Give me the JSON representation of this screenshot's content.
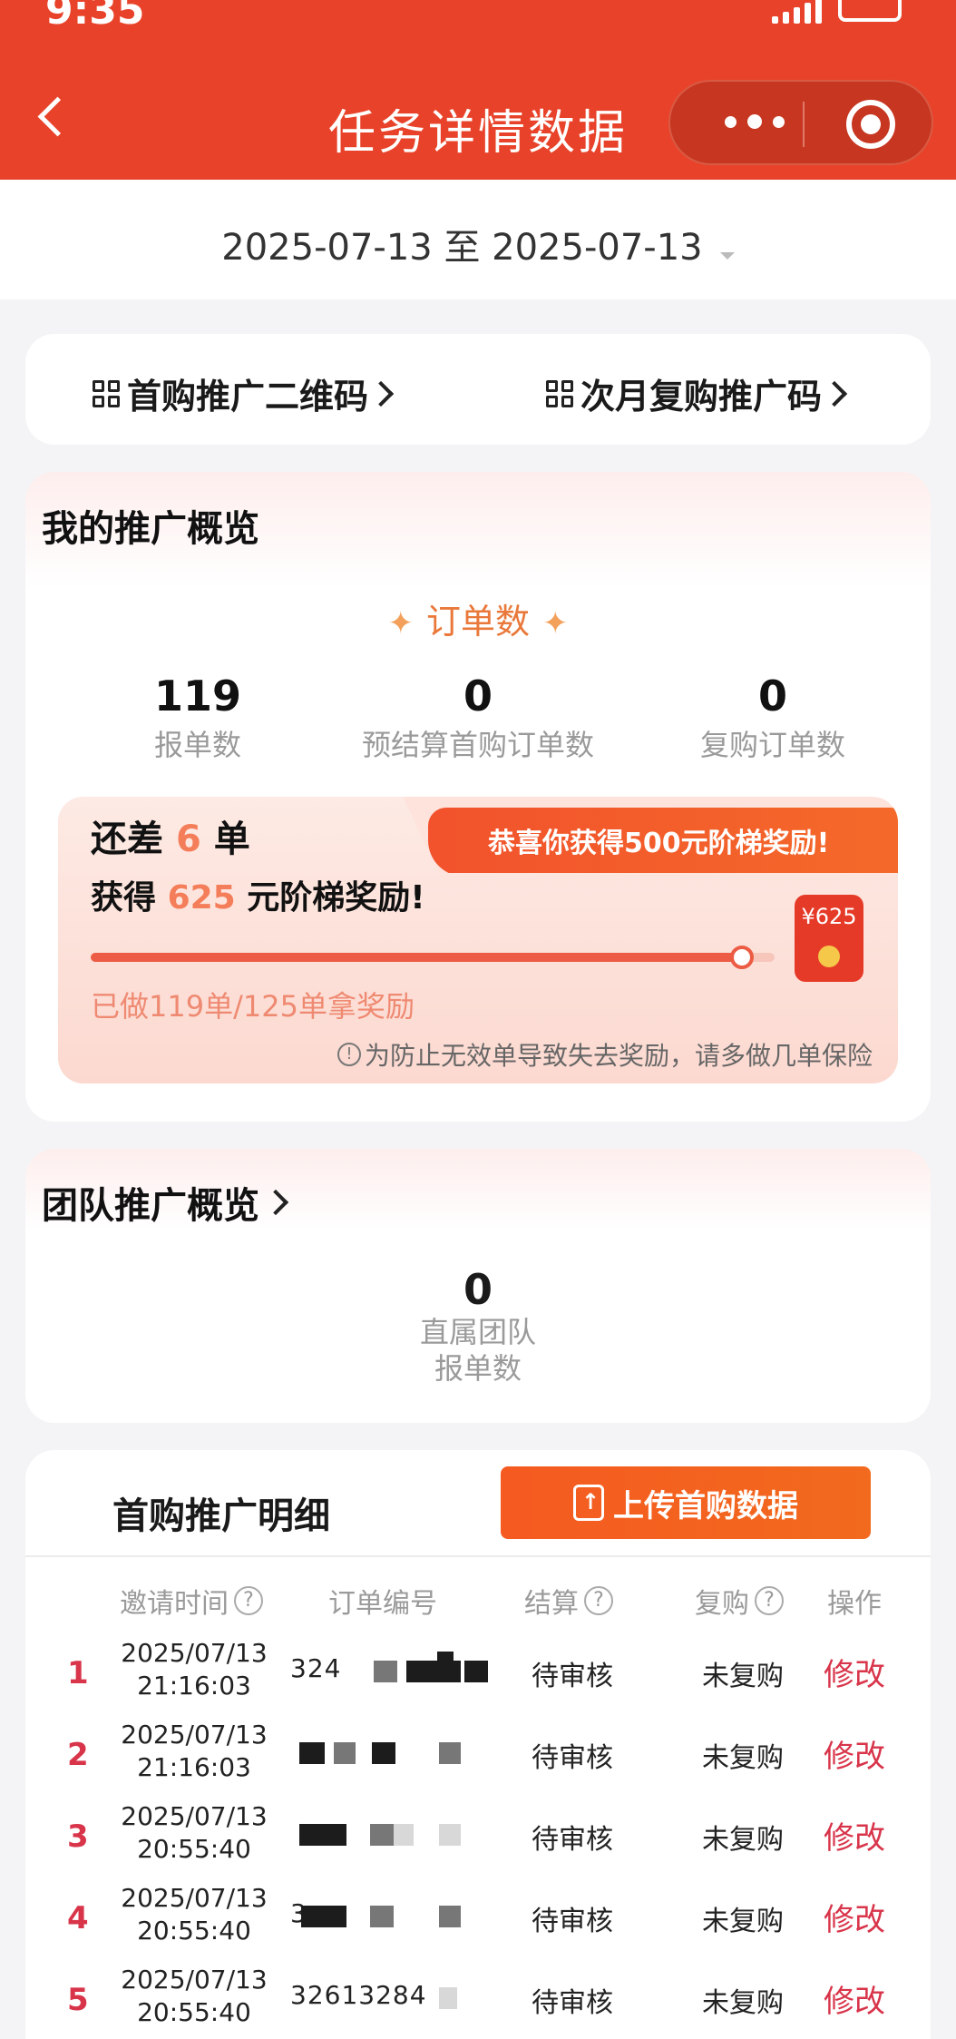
{
  "status_bar": {
    "time": "9:35"
  },
  "header": {
    "title": "任务详情数据"
  },
  "date_range": {
    "text": "2025-07-13 至 2025-07-13"
  },
  "qr_links": [
    {
      "label": "首购推广二维码"
    },
    {
      "label": "次月复购推广码"
    }
  ],
  "overview": {
    "title": "我的推广概览",
    "metric_head": "订单数",
    "metrics": [
      {
        "value": "119",
        "label": "报单数"
      },
      {
        "value": "0",
        "label": "预结算首购订单数"
      },
      {
        "value": "0",
        "label": "复购订单数"
      }
    ],
    "reward": {
      "badge": "恭喜你获得500元阶梯奖励!",
      "line1_prefix": "还差",
      "line1_count": "6",
      "line1_suffix": "单",
      "line2_prefix": "获得",
      "line2_amount": "625",
      "line2_suffix": "元阶梯奖励!",
      "progress_fraction": 0.952,
      "redpack_label": "¥625",
      "progress_text": "已做119单/125单拿奖励",
      "note": "为防止无效单导致失去奖励，请多做几单保险"
    }
  },
  "team": {
    "title": "团队推广概览",
    "value": "0",
    "label_line1": "直属团队",
    "label_line2": "报单数"
  },
  "detail": {
    "title": "首购推广明细",
    "upload_label": "上传首购数据",
    "columns": {
      "time": "邀请时间",
      "order": "订单编号",
      "settle": "结算",
      "repurchase": "复购",
      "action": "操作"
    },
    "rows": [
      {
        "idx": "1",
        "date": "2025/07/13",
        "time": "21:16:03",
        "order": "324",
        "settle": "待审核",
        "repurchase": "未复购",
        "action": "修改"
      },
      {
        "idx": "2",
        "date": "2025/07/13",
        "time": "21:16:03",
        "order": "",
        "settle": "待审核",
        "repurchase": "未复购",
        "action": "修改"
      },
      {
        "idx": "3",
        "date": "2025/07/13",
        "time": "20:55:40",
        "order": "",
        "settle": "待审核",
        "repurchase": "未复购",
        "action": "修改"
      },
      {
        "idx": "4",
        "date": "2025/07/13",
        "time": "20:55:40",
        "order": "3",
        "settle": "待审核",
        "repurchase": "未复购",
        "action": "修改"
      },
      {
        "idx": "5",
        "date": "2025/07/13",
        "time": "20:55:40",
        "order": "32613284",
        "settle": "待审核",
        "repurchase": "未复购",
        "action": "修改"
      }
    ]
  }
}
